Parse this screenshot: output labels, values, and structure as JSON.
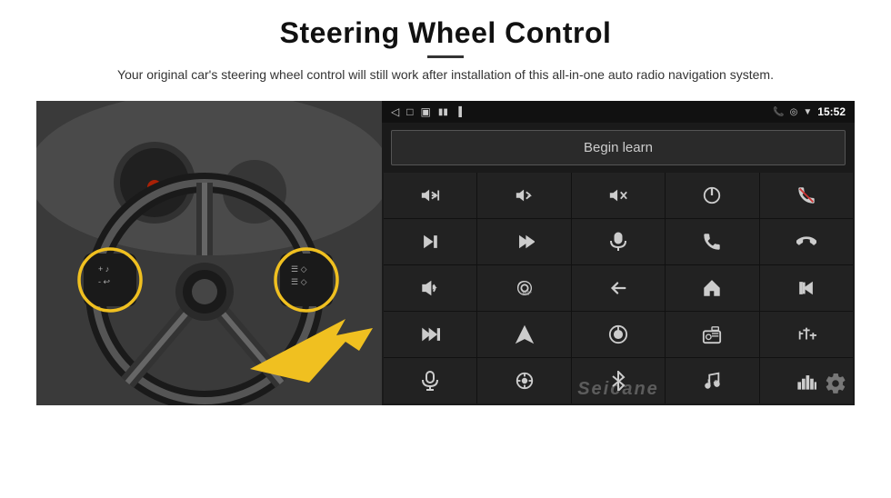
{
  "page": {
    "title": "Steering Wheel Control",
    "subtitle": "Your original car's steering wheel control will still work after installation of this all-in-one auto radio navigation system.",
    "divider": "—"
  },
  "status_bar": {
    "time": "15:52",
    "back_icon": "◁",
    "home_icon": "□",
    "recents_icon": "▣",
    "phone_icon": "📞",
    "location_icon": "◎",
    "wifi_icon": "▼",
    "signal_label": "15:52"
  },
  "begin_learn": {
    "label": "Begin learn"
  },
  "watermark": {
    "text": "Seicane"
  },
  "controls": [
    {
      "id": "vol-up",
      "icon": "vol_up"
    },
    {
      "id": "vol-down",
      "icon": "vol_down"
    },
    {
      "id": "mute",
      "icon": "mute"
    },
    {
      "id": "power",
      "icon": "power"
    },
    {
      "id": "phone-end",
      "icon": "phone_end"
    },
    {
      "id": "next-track",
      "icon": "next_track"
    },
    {
      "id": "skip-forward",
      "icon": "skip_fwd"
    },
    {
      "id": "mic",
      "icon": "mic"
    },
    {
      "id": "phone",
      "icon": "phone"
    },
    {
      "id": "hang-up",
      "icon": "hang_up"
    },
    {
      "id": "speaker",
      "icon": "speaker"
    },
    {
      "id": "cam360",
      "icon": "cam360"
    },
    {
      "id": "back",
      "icon": "back"
    },
    {
      "id": "home",
      "icon": "home"
    },
    {
      "id": "prev-track",
      "icon": "prev_track"
    },
    {
      "id": "fast-forward",
      "icon": "fast_fwd"
    },
    {
      "id": "nav",
      "icon": "nav"
    },
    {
      "id": "eject",
      "icon": "eject"
    },
    {
      "id": "radio",
      "icon": "radio"
    },
    {
      "id": "equalizer",
      "icon": "equalizer"
    },
    {
      "id": "mic2",
      "icon": "mic2"
    },
    {
      "id": "settings-round",
      "icon": "settings_round"
    },
    {
      "id": "bluetooth",
      "icon": "bluetooth"
    },
    {
      "id": "music",
      "icon": "music"
    },
    {
      "id": "spectrum",
      "icon": "spectrum"
    }
  ]
}
